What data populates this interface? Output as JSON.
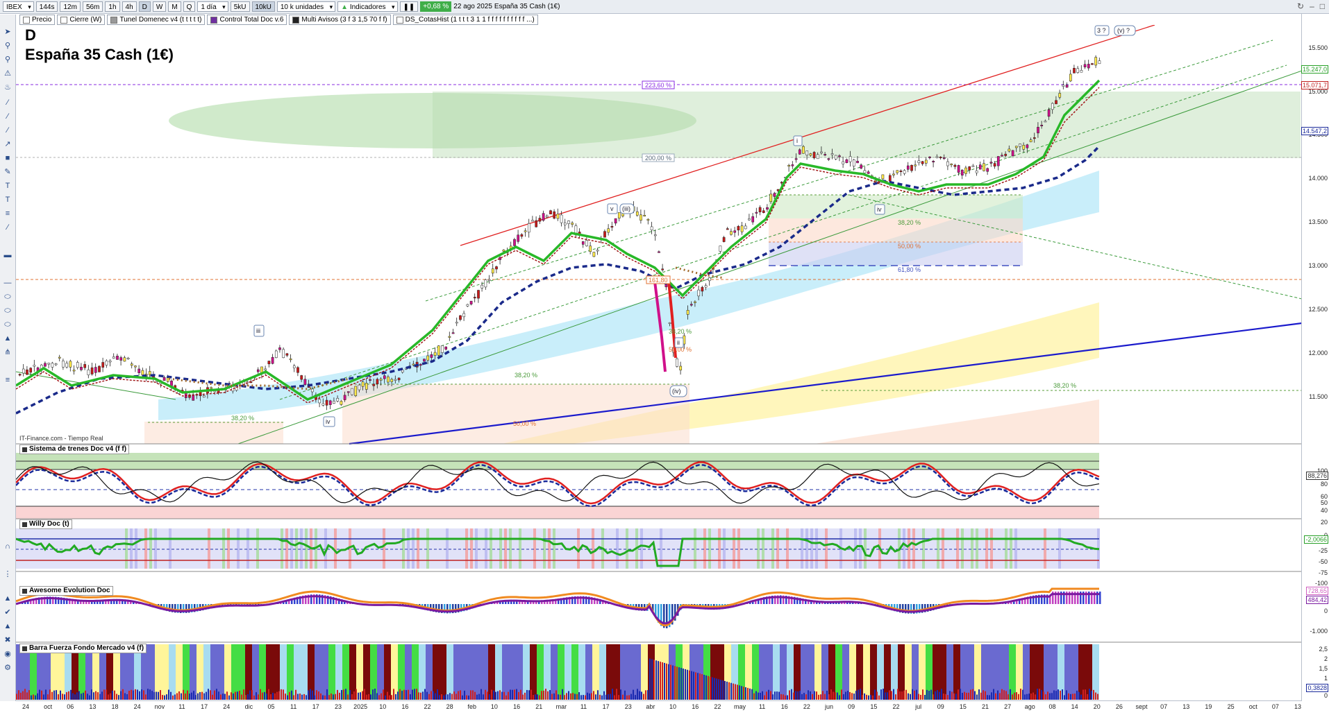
{
  "toolbar": {
    "symbol": "IBEX",
    "timeframes": [
      "144s",
      "12m",
      "56m",
      "1h",
      "4h",
      "D",
      "W",
      "M",
      "Q"
    ],
    "active_timeframe": "D",
    "period": "1 día",
    "units": [
      "5kU",
      "10kU"
    ],
    "active_unit": "10kU",
    "units_select": "10 k unidades",
    "indicators_label": "Indicadores",
    "change": "+0,68 %",
    "date": "22 ago 2025",
    "instrument": "España 35 Cash (1€)"
  },
  "indicator_tabs": [
    {
      "label": "Precio",
      "color": "#ffffff"
    },
    {
      "label": "Cierre (W)",
      "color": "#ffffff"
    },
    {
      "label": "Tunel Domenec v4 (t t t t t)",
      "color": "#999999"
    },
    {
      "label": "Control Total Doc v.6",
      "color": "#7030a0"
    },
    {
      "label": "Multi Avisos (3 f 3 1,5 70 f f)",
      "color": "#222222"
    },
    {
      "label": "DS_CotasHist (1 t t t 3 1 1 f f f f f f f f f f ...)",
      "color": "#ffffff"
    }
  ],
  "chart": {
    "period_letter": "D",
    "title": "España 35 Cash (1€)",
    "source": "IT-Finance.com - Tiempo Real",
    "fib_labels": {
      "f223": "223,60 %",
      "f200": "200,00 %",
      "f161": "161,80",
      "f382a": "38,20 %",
      "f500a": "50,00 %",
      "f618a": "61,80 %",
      "f382b": "38,20 %",
      "f382c": "38,20 %",
      "f382d": "38,20 %",
      "f500b": "50,00 %",
      "f500c": "50,00 %",
      "f382e": "38,20 %",
      "f500d": "50,00 %"
    },
    "wave_labels": {
      "w3q": "3 ?",
      "wvq": "(v) ?",
      "wv": "v",
      "wiii": "(iii)",
      "wiv_top": "iv",
      "wiii_left": "iii",
      "wiv_left": "iv",
      "wii": "ii",
      "wiv_paren": "(iv)",
      "wsmall": "i"
    }
  },
  "price_axis": {
    "ticks": [
      "15.500",
      "15.000",
      "14.500",
      "14.000",
      "13.500",
      "13.000",
      "12.500",
      "12.000",
      "11.500"
    ],
    "last": "15.247,0",
    "level_red": "15.071,7",
    "level_blue": "14.547,2"
  },
  "panels": {
    "trenes": {
      "title": "Sistema de trenes Doc v4 (f f)",
      "ticks": [
        "100",
        "80",
        "60",
        "50",
        "40",
        "20",
        "0"
      ],
      "value": "88,276"
    },
    "willy": {
      "title": "Willy Doc (t)",
      "ticks": [
        "-25",
        "-50",
        "-75",
        "-100"
      ],
      "value": "-2,0066"
    },
    "awesome": {
      "title": "Awesome Evolution Doc",
      "ticks": [
        "0",
        "-1.000"
      ],
      "value1": "728,65",
      "value2": "484,42"
    },
    "barra": {
      "title": "Barra Fuerza Fondo Mercado v4 (f)",
      "ticks": [
        "2,5",
        "2",
        "1,5",
        "1",
        "0"
      ],
      "value": "0,3828"
    }
  },
  "date_axis": [
    "24",
    "oct",
    "06",
    "13",
    "18",
    "24",
    "nov",
    "11",
    "17",
    "24",
    "dic",
    "05",
    "11",
    "17",
    "23",
    "2025",
    "10",
    "16",
    "22",
    "28",
    "feb",
    "10",
    "16",
    "21",
    "mar",
    "11",
    "17",
    "23",
    "abr",
    "10",
    "16",
    "22",
    "may",
    "11",
    "16",
    "22",
    "jun",
    "09",
    "15",
    "22",
    "jul",
    "09",
    "15",
    "21",
    "27",
    "ago",
    "08",
    "14",
    "20",
    "26",
    "sept",
    "07",
    "13",
    "19",
    "25",
    "oct",
    "07",
    "13"
  ]
}
